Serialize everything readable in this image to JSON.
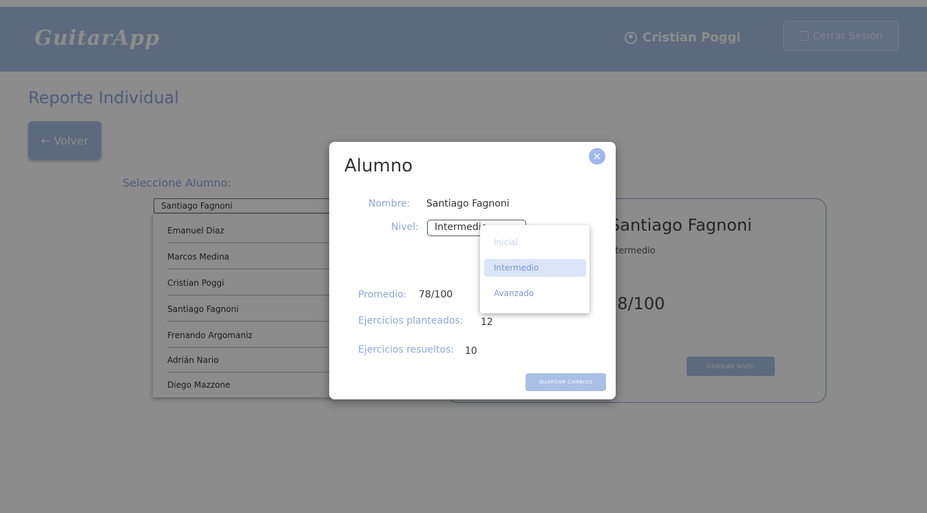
{
  "header": {
    "logo": "GuitarApp",
    "user_name": "Cristian Poggi",
    "logout_label": "Cerrar Sesión"
  },
  "page": {
    "title": "Reporte Individual",
    "back_label": "← Volver",
    "select_label": "Seleccione Alumno:",
    "selected_student": "Santiago Fagnoni",
    "students": [
      "Emanuel Diaz",
      "Marcos Medina",
      "Cristian Poggi",
      "Santiago Fagnoni",
      "Frenando Argomaniz",
      "Adrián Nario",
      "Diego Mazzone"
    ]
  },
  "card": {
    "name": "Santiago Fagnoni",
    "level": "Intermedio",
    "score": "78/100",
    "change_level_label": "CAMBIAR NIVEL"
  },
  "modal": {
    "title": "Alumno",
    "close_icon": "×",
    "name_label": "Nombre:",
    "name_value": "Santiago Fagnoni",
    "level_label": "Nivel:",
    "level_value": "Intermedio",
    "avg_label": "Promedio:",
    "avg_value": "78/100",
    "planned_label": "Ejercicios planteados:",
    "planned_value": "12",
    "solved_label": "Ejercicios resueltos:",
    "solved_value": "10",
    "save_label": "GUARDAR CAMBIOS"
  },
  "dropdown": {
    "options": [
      "Inicial",
      "Intermedio",
      "Avanzado"
    ],
    "selected": "Intermedio"
  },
  "colors": {
    "primary": "#a9bfe6",
    "accent_text": "#8ea8e0",
    "overlay": "rgba(0,0,0,0.45)"
  }
}
